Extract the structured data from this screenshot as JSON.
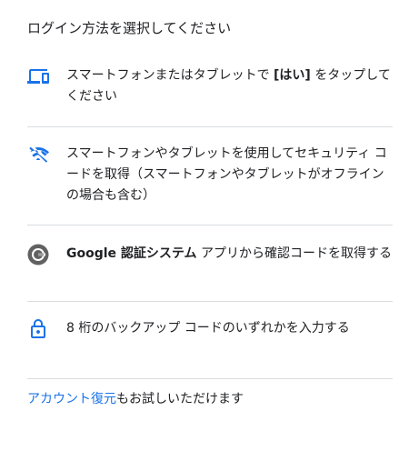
{
  "heading": "ログイン方法を選択してください",
  "options": [
    {
      "icon": "devices-icon",
      "text_before": "スマートフォンまたはタブレットで ",
      "text_bold": "[はい]",
      "text_after": " をタップしてください"
    },
    {
      "icon": "phone-off-icon",
      "text": "スマートフォンやタブレットを使用してセキュリティ コードを取得（スマートフォンやタブレットがオフラインの場合も含む）"
    },
    {
      "icon": "google-authenticator-icon",
      "text_bold": "Google 認証システム",
      "text_after": " アプリから確認コードを取得する"
    },
    {
      "icon": "lock-icon",
      "text": "8 桁のバックアップ コードのいずれかを入力する"
    }
  ],
  "footer": {
    "link_text": "アカウント復元",
    "suffix_text": "もお試しいただけます"
  },
  "colors": {
    "accent": "#1a73e8",
    "text": "#202124",
    "divider": "#dadce0"
  }
}
